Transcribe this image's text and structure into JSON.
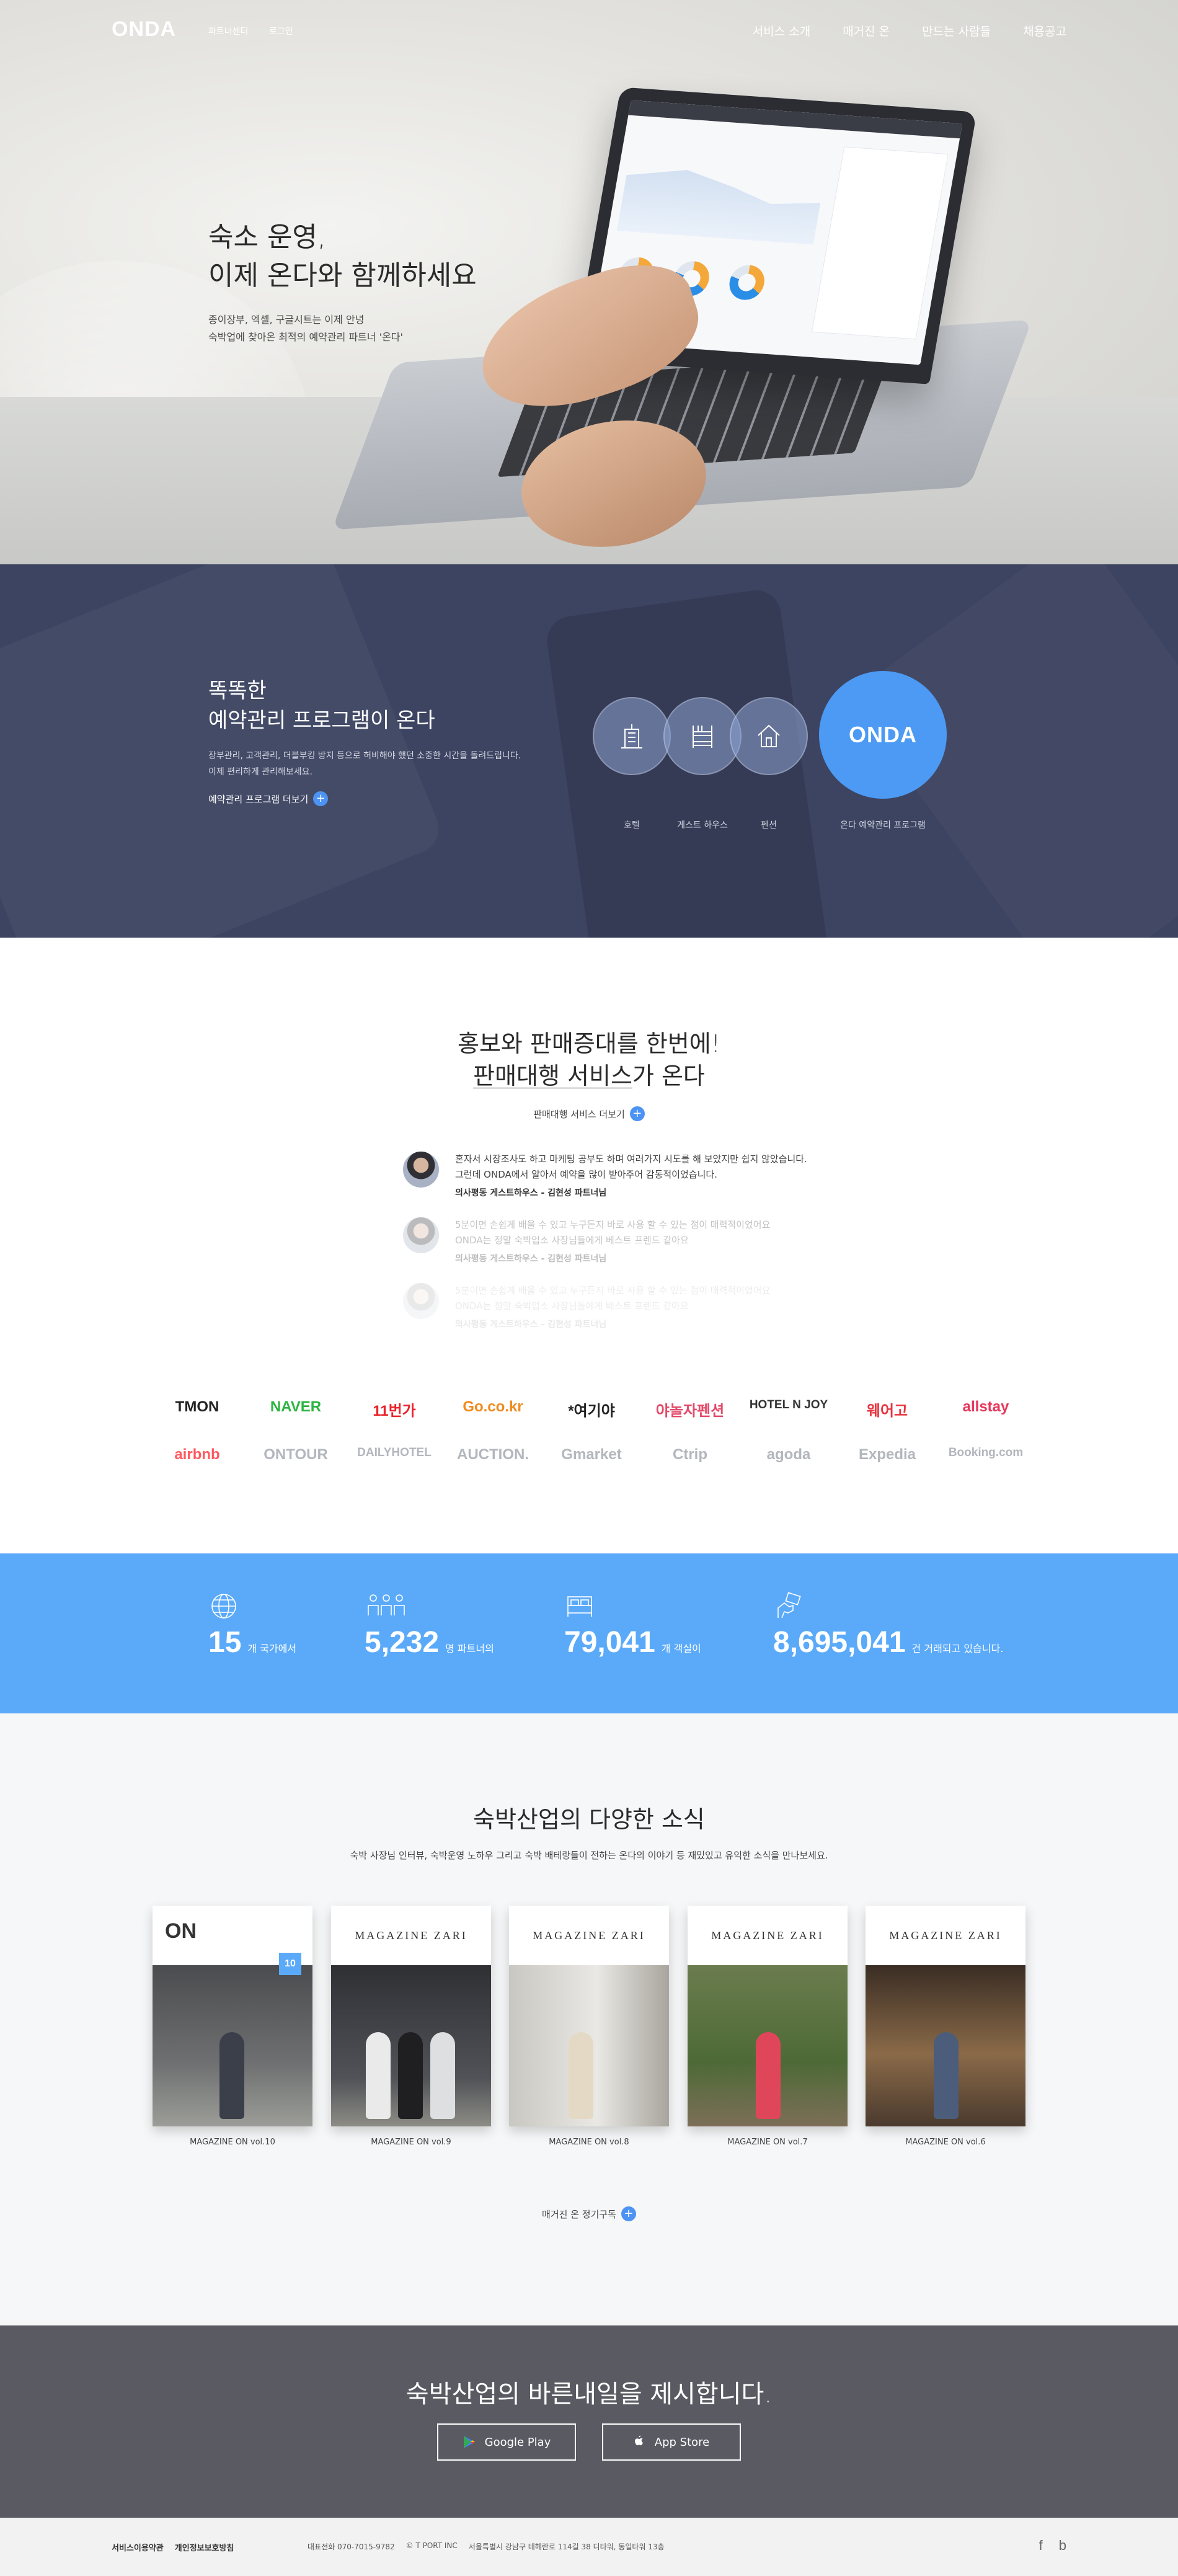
{
  "header": {
    "logo": "ONDA",
    "sub_links": [
      "파트너센터",
      "로그인"
    ],
    "menu": [
      "서비스 소개",
      "매거진 온",
      "만드는 사람들",
      "채용공고"
    ]
  },
  "hero": {
    "title": "숙소 운영,\n이제 온다와 함께하세요",
    "description": "종이장부, 엑셀, 구글시트는 이제 안녕\n숙박업에 찾아온 최적의 예약관리 파트너 '온다'"
  },
  "program": {
    "title": "똑똑한\n예약관리 프로그램이 온다",
    "description": "장부관리, 고객관리, 더블부킹 방지 등으로 허비해야 했던 소중한 시간을 돌려드립니다.\n이제 편리하게 관리해보세요.",
    "more_label": "예약관리 프로그램 더보기",
    "types": [
      "호텔",
      "게스트 하우스",
      "펜션"
    ],
    "onda_circle": "ONDA",
    "onda_label": "온다 예약관리 프로그램"
  },
  "promo": {
    "title_line1": "홍보와 판매증대를 한번에!",
    "title_line2_underlined": "판매대행 서비스",
    "title_line2_rest": "가 온다",
    "more_label": "판매대행 서비스 더보기",
    "reviews": [
      {
        "text": "혼자서 시장조사도 하고 마케팅 공부도 하며 여러가지 시도를 해 보았지만 쉽지 않았습니다.\n그런데 ONDA에서 알아서 예약을 많이 받아주어 감동적이었습니다.",
        "author": "의사평동 게스트하우스 - 김현성 파트너님"
      },
      {
        "text": "5분이면 손쉽게 배울 수 있고 누구든지 바로 사용 할 수 있는 점이 매력적이었어요\nONDA는 정말 숙박업소 사장님들에게 베스트 프렌드 같아요",
        "author": "의사평동 게스트하우스 - 김현성 파트너님"
      },
      {
        "text": "5분이면 손쉽게 배울 수 있고 누구든지 바로 사용 할 수 있는 점이 매력적이었어요\nONDA는 정말 숙박업소 사장님들에게 베스트 프렌드 같아요",
        "author": "의사평동 게스트하우스 - 김현성 파트너님"
      }
    ],
    "partners_row1": [
      "TMON",
      "NAVER",
      "11번가",
      "Go.co.kr",
      "*여기야",
      "야놀자펜션",
      "HOTEL N JOY",
      "웨어고",
      "allstay"
    ],
    "partners_row2": [
      "airbnb",
      "ONTOUR",
      "DAILYHOTEL",
      "AUCTION.",
      "Gmarket",
      "Ctrip",
      "agoda",
      "Expedia",
      "Booking.com"
    ],
    "partner_colors_row1": [
      "#222222",
      "#2cb441",
      "#e8232a",
      "#f08a1d",
      "#222222",
      "#e24a6a",
      "#333333",
      "#e8353f",
      "#e8355a"
    ],
    "partner_colors_row2": [
      "#ff5a5f",
      "#b3b6bd",
      "#b3b6bd",
      "#b3b6bd",
      "#b3b6bd",
      "#b3b6bd",
      "#b3b6bd",
      "#b3b6bd",
      "#b3b6bd"
    ]
  },
  "stats": [
    {
      "icon": "globe-icon",
      "value": "15",
      "unit": "개 국가에서"
    },
    {
      "icon": "people-icon",
      "value": "5,232",
      "unit": "명 파트너의"
    },
    {
      "icon": "bed-icon",
      "value": "79,041",
      "unit": "개 객실이"
    },
    {
      "icon": "hand-card-icon",
      "value": "8,695,041",
      "unit": "건 거래되고 있습니다."
    }
  ],
  "news": {
    "title": "숙박산업의 다양한 소식",
    "description": "숙박 사장님 인터뷰, 숙박운영 노하우 그리고 숙박 배테랑들이 전하는 온다의 이야기 등 재밌있고 유익한 소식을 만나보세요.",
    "magazines": [
      {
        "mast": "ON",
        "badge": "10",
        "caption": "MAGAZINE ON vol.10"
      },
      {
        "mast": "MAGAZINE ZARI",
        "caption": "MAGAZINE ON vol.9"
      },
      {
        "mast": "MAGAZINE ZARI",
        "caption": "MAGAZINE ON vol.8"
      },
      {
        "mast": "MAGAZINE ZARI",
        "caption": "MAGAZINE ON vol.7"
      },
      {
        "mast": "MAGAZINE ZARI",
        "caption": "MAGAZINE ON vol.6"
      }
    ],
    "more_label": "매거진 온 정기구독"
  },
  "app": {
    "title": "숙박산업의 바른내일을 제시합니다.",
    "google_play": "Google Play",
    "app_store": "App Store"
  },
  "footer": {
    "links": [
      "서비스이용약관",
      "개인정보보호방침"
    ],
    "phone": "대표전화 070-7015-9782",
    "company": "© T PORT INC",
    "address": "서울특별시 강남구 테헤란로 114길 38 디타워, 동일타워 13층",
    "social": [
      "f",
      "b"
    ]
  }
}
